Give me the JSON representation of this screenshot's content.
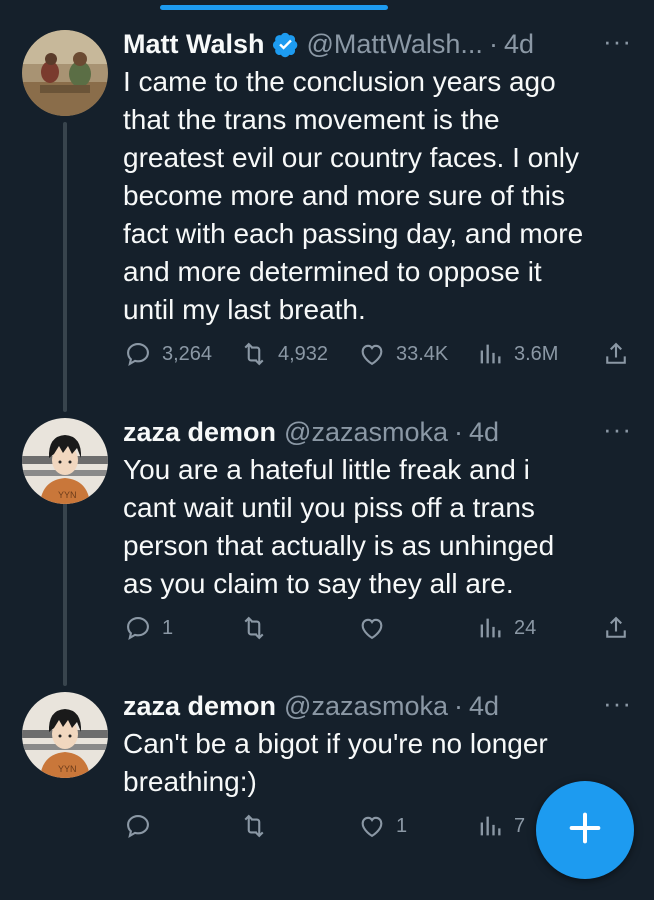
{
  "tweets": [
    {
      "name": "Matt Walsh",
      "verified": true,
      "handle": "@MattWalsh...",
      "time": "4d",
      "more": "···",
      "text_lines": [
        "I came to the conclusion years ago",
        "that the trans movement is the",
        "greatest evil our country faces. I only",
        "become more and more sure of this",
        "fact with each passing day, and more",
        "and more determined to oppose it",
        "until my last breath."
      ],
      "replies": "3,264",
      "retweets": "4,932",
      "likes": "33.4K",
      "views": "3.6M"
    },
    {
      "name": "zaza demon",
      "handle": "@zazasmoka",
      "time": "4d",
      "more": "···",
      "text_lines": [
        "You are a hateful little freak and i",
        "cant wait until you piss off a trans",
        "person that actually is as unhinged",
        "as you claim to say they all are."
      ],
      "replies": "1",
      "retweets": "",
      "likes": "",
      "views": "24"
    },
    {
      "name": "zaza demon",
      "handle": "@zazasmoka",
      "time": "4d",
      "more": "···",
      "text_lines": [
        "Can't be a bigot if you're no longer",
        "breathing:)"
      ],
      "replies": "",
      "retweets": "",
      "likes": "1",
      "views": "7"
    }
  ],
  "dot": "·",
  "icons": [
    "reply-icon",
    "retweet-icon",
    "like-icon",
    "views-icon",
    "share-icon",
    "compose-plus-icon",
    "verified-badge-icon",
    "more-icon"
  ],
  "colors": {
    "background": "#15202b",
    "accent": "#1d9bf0",
    "muted": "#8b98a5",
    "text": "#f7f9f9"
  }
}
